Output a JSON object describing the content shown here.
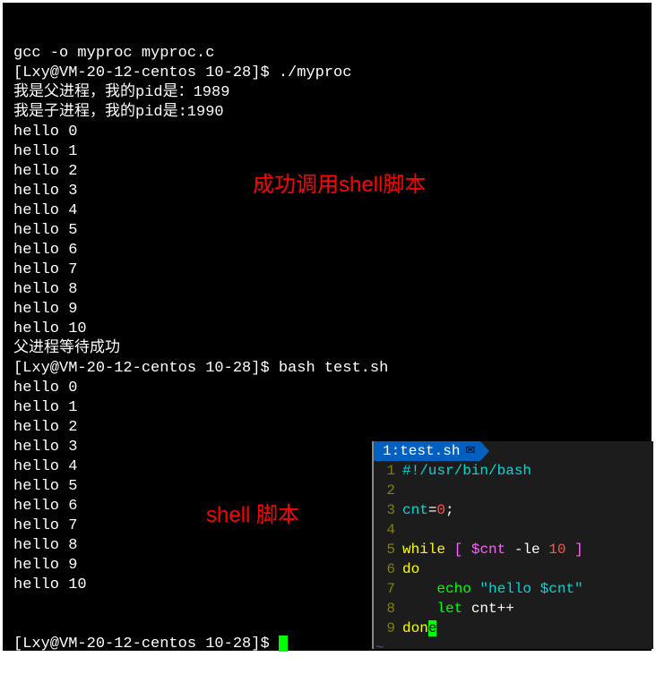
{
  "terminal": {
    "lines": [
      "gcc -o myproc myproc.c",
      "[Lxy@VM-20-12-centos 10-28]$ ./myproc",
      "我是父进程，我的pid是：1989",
      "我是子进程，我的pid是:1990",
      "hello 0",
      "hello 1",
      "hello 2",
      "hello 3",
      "hello 4",
      "hello 5",
      "hello 6",
      "hello 7",
      "hello 8",
      "hello 9",
      "hello 10",
      "父进程等待成功",
      "[Lxy@VM-20-12-centos 10-28]$ bash test.sh",
      "hello 0",
      "hello 1",
      "hello 2",
      "hello 3",
      "hello 4",
      "hello 5",
      "hello 6",
      "hello 7",
      "hello 8",
      "hello 9",
      "hello 10"
    ],
    "final_prompt": "[Lxy@VM-20-12-centos 10-28]$ "
  },
  "annotations": {
    "top": "成功调用shell脚本",
    "bottom": "shell 脚本"
  },
  "editor": {
    "tab_num": "1:",
    "tab_name": " test.sh ",
    "lines": [
      {
        "n": "1",
        "segs": [
          {
            "t": "#!/usr/bin/bash",
            "c": "c-cyan"
          }
        ]
      },
      {
        "n": "2",
        "segs": []
      },
      {
        "n": "3",
        "segs": [
          {
            "t": "cnt",
            "c": "c-cyan"
          },
          {
            "t": "=",
            "c": ""
          },
          {
            "t": "0",
            "c": "c-red"
          },
          {
            "t": ";",
            "c": ""
          }
        ]
      },
      {
        "n": "4",
        "segs": []
      },
      {
        "n": "5",
        "segs": [
          {
            "t": "while",
            "c": "c-yellow"
          },
          {
            "t": " ",
            "c": ""
          },
          {
            "t": "[",
            "c": "c-magenta"
          },
          {
            "t": " ",
            "c": ""
          },
          {
            "t": "$cnt",
            "c": "c-magenta"
          },
          {
            "t": " -le ",
            "c": ""
          },
          {
            "t": "10",
            "c": "c-red"
          },
          {
            "t": " ",
            "c": ""
          },
          {
            "t": "]",
            "c": "c-magenta"
          }
        ]
      },
      {
        "n": "6",
        "segs": [
          {
            "t": "do",
            "c": "c-yellow"
          }
        ]
      },
      {
        "n": "7",
        "segs": [
          {
            "t": "    ",
            "c": ""
          },
          {
            "t": "echo",
            "c": "c-green"
          },
          {
            "t": " ",
            "c": ""
          },
          {
            "t": "\"hello $cnt\"",
            "c": "c-cyan"
          }
        ]
      },
      {
        "n": "8",
        "segs": [
          {
            "t": "    ",
            "c": ""
          },
          {
            "t": "let",
            "c": "c-green"
          },
          {
            "t": " cnt++",
            "c": ""
          }
        ]
      },
      {
        "n": "9",
        "segs": [
          {
            "t": "don",
            "c": "c-yellow"
          },
          {
            "t": "e",
            "c": "ed-cursor"
          }
        ]
      }
    ],
    "tilde": "~"
  }
}
